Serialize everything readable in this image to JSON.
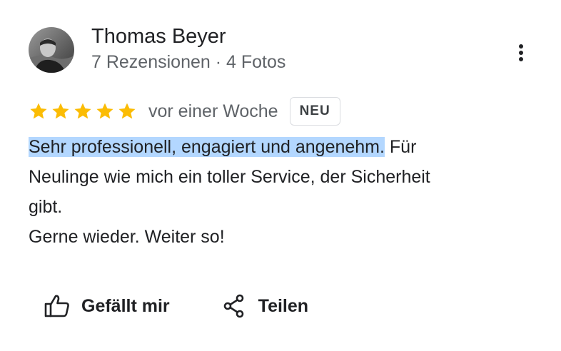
{
  "author": {
    "name": "Thomas Beyer",
    "meta": "7 Rezensionen · 4 Fotos"
  },
  "review": {
    "rating": 5,
    "max_rating": 5,
    "date": "vor einer Woche",
    "badge": "NEU",
    "text_highlighted": "Sehr professionell, engagiert und angenehm.",
    "text_line1_rest": " Für",
    "text_line2": "Neulinge wie mich ein toller Service, der Sicherheit",
    "text_line3": "gibt.",
    "text_line4": "Gerne wieder. Weiter so!"
  },
  "actions": {
    "like_label": "Gefällt mir",
    "share_label": "Teilen"
  },
  "icons": {
    "star": "star-icon",
    "more": "more-vert-icon",
    "like": "thumb-up-icon",
    "share": "share-icon"
  },
  "colors": {
    "star": "#fbbc04",
    "highlight": "#b3d7ff",
    "secondary_text": "#5f6368",
    "primary_text": "#202124"
  }
}
